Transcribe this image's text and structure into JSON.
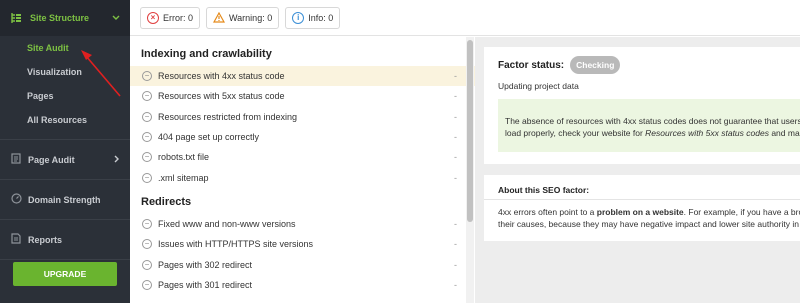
{
  "sidebar": {
    "header": {
      "label": "Site Structure",
      "icon": "tree-icon"
    },
    "sub_items": [
      {
        "label": "Site Audit",
        "active": true
      },
      {
        "label": "Visualization",
        "active": false
      },
      {
        "label": "Pages",
        "active": false
      },
      {
        "label": "All Resources",
        "active": false
      }
    ],
    "items": [
      {
        "label": "Page Audit",
        "icon": "page-icon",
        "has_chevron": true
      },
      {
        "label": "Domain Strength",
        "icon": "gauge-icon",
        "has_chevron": false
      },
      {
        "label": "Reports",
        "icon": "report-icon",
        "has_chevron": false
      }
    ],
    "upgrade_label": "UPGRADE"
  },
  "topbar": {
    "error": "Error: 0",
    "warning": "Warning: 0",
    "info": "Info: 0"
  },
  "list": {
    "sections": [
      {
        "title": "Indexing and crawlability",
        "rows": [
          {
            "label": "Resources with 4xx status code",
            "value": "-",
            "selected": true
          },
          {
            "label": "Resources with 5xx status code",
            "value": "-"
          },
          {
            "label": "Resources restricted from indexing",
            "value": "-"
          },
          {
            "label": "404 page set up correctly",
            "value": "-"
          },
          {
            "label": "robots.txt file",
            "value": "-"
          },
          {
            "label": ".xml sitemap",
            "value": "-"
          }
        ]
      },
      {
        "title": "Redirects",
        "rows": [
          {
            "label": "Fixed www and non-www versions",
            "value": "-"
          },
          {
            "label": "Issues with HTTP/HTTPS site versions",
            "value": "-"
          },
          {
            "label": "Pages with 302 redirect",
            "value": "-"
          },
          {
            "label": "Pages with 301 redirect",
            "value": "-"
          }
        ]
      }
    ]
  },
  "factor": {
    "status_label": "Factor status:",
    "status_value": "Checking",
    "updating": "Updating project data",
    "note_line1": "The absence of resources with 4xx status codes does not guarantee that users",
    "note_line2_prefix": "load properly, check your website for ",
    "note_line2_italic": "Resources with 5xx status codes",
    "note_line2_suffix": " and make"
  },
  "about": {
    "title": "About this SEO factor:",
    "line1_prefix": "4xx errors often point to a ",
    "line1_bold": "problem on a website",
    "line1_suffix": ". For example, if you have a broke",
    "line2": "their causes, because they may have negative impact and lower site authority in u"
  },
  "colors": {
    "accent_green": "#7dc143",
    "sidebar_bg": "#2b3038",
    "upgrade_bg": "#6ab42f",
    "selected_row": "#faf3de",
    "note_bg": "#ecf6e1",
    "arrow": "#e02020"
  }
}
